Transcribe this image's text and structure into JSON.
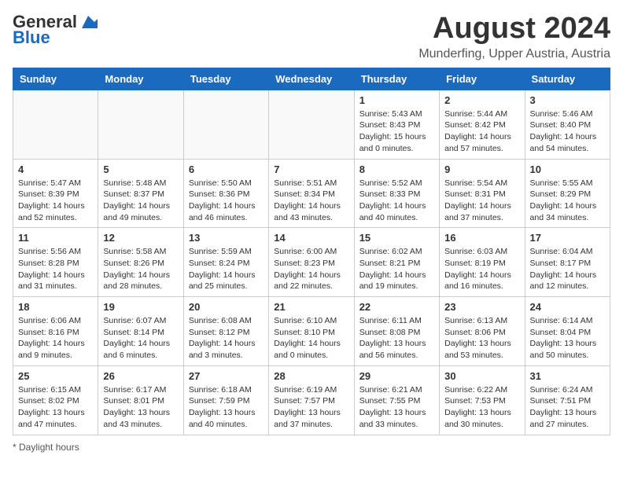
{
  "logo": {
    "line1": "General",
    "line2": "Blue"
  },
  "title": "August 2024",
  "subtitle": "Munderfing, Upper Austria, Austria",
  "day_headers": [
    "Sunday",
    "Monday",
    "Tuesday",
    "Wednesday",
    "Thursday",
    "Friday",
    "Saturday"
  ],
  "weeks": [
    [
      {
        "day": "",
        "info": ""
      },
      {
        "day": "",
        "info": ""
      },
      {
        "day": "",
        "info": ""
      },
      {
        "day": "",
        "info": ""
      },
      {
        "day": "1",
        "info": "Sunrise: 5:43 AM\nSunset: 8:43 PM\nDaylight: 15 hours and 0 minutes."
      },
      {
        "day": "2",
        "info": "Sunrise: 5:44 AM\nSunset: 8:42 PM\nDaylight: 14 hours and 57 minutes."
      },
      {
        "day": "3",
        "info": "Sunrise: 5:46 AM\nSunset: 8:40 PM\nDaylight: 14 hours and 54 minutes."
      }
    ],
    [
      {
        "day": "4",
        "info": "Sunrise: 5:47 AM\nSunset: 8:39 PM\nDaylight: 14 hours and 52 minutes."
      },
      {
        "day": "5",
        "info": "Sunrise: 5:48 AM\nSunset: 8:37 PM\nDaylight: 14 hours and 49 minutes."
      },
      {
        "day": "6",
        "info": "Sunrise: 5:50 AM\nSunset: 8:36 PM\nDaylight: 14 hours and 46 minutes."
      },
      {
        "day": "7",
        "info": "Sunrise: 5:51 AM\nSunset: 8:34 PM\nDaylight: 14 hours and 43 minutes."
      },
      {
        "day": "8",
        "info": "Sunrise: 5:52 AM\nSunset: 8:33 PM\nDaylight: 14 hours and 40 minutes."
      },
      {
        "day": "9",
        "info": "Sunrise: 5:54 AM\nSunset: 8:31 PM\nDaylight: 14 hours and 37 minutes."
      },
      {
        "day": "10",
        "info": "Sunrise: 5:55 AM\nSunset: 8:29 PM\nDaylight: 14 hours and 34 minutes."
      }
    ],
    [
      {
        "day": "11",
        "info": "Sunrise: 5:56 AM\nSunset: 8:28 PM\nDaylight: 14 hours and 31 minutes."
      },
      {
        "day": "12",
        "info": "Sunrise: 5:58 AM\nSunset: 8:26 PM\nDaylight: 14 hours and 28 minutes."
      },
      {
        "day": "13",
        "info": "Sunrise: 5:59 AM\nSunset: 8:24 PM\nDaylight: 14 hours and 25 minutes."
      },
      {
        "day": "14",
        "info": "Sunrise: 6:00 AM\nSunset: 8:23 PM\nDaylight: 14 hours and 22 minutes."
      },
      {
        "day": "15",
        "info": "Sunrise: 6:02 AM\nSunset: 8:21 PM\nDaylight: 14 hours and 19 minutes."
      },
      {
        "day": "16",
        "info": "Sunrise: 6:03 AM\nSunset: 8:19 PM\nDaylight: 14 hours and 16 minutes."
      },
      {
        "day": "17",
        "info": "Sunrise: 6:04 AM\nSunset: 8:17 PM\nDaylight: 14 hours and 12 minutes."
      }
    ],
    [
      {
        "day": "18",
        "info": "Sunrise: 6:06 AM\nSunset: 8:16 PM\nDaylight: 14 hours and 9 minutes."
      },
      {
        "day": "19",
        "info": "Sunrise: 6:07 AM\nSunset: 8:14 PM\nDaylight: 14 hours and 6 minutes."
      },
      {
        "day": "20",
        "info": "Sunrise: 6:08 AM\nSunset: 8:12 PM\nDaylight: 14 hours and 3 minutes."
      },
      {
        "day": "21",
        "info": "Sunrise: 6:10 AM\nSunset: 8:10 PM\nDaylight: 14 hours and 0 minutes."
      },
      {
        "day": "22",
        "info": "Sunrise: 6:11 AM\nSunset: 8:08 PM\nDaylight: 13 hours and 56 minutes."
      },
      {
        "day": "23",
        "info": "Sunrise: 6:13 AM\nSunset: 8:06 PM\nDaylight: 13 hours and 53 minutes."
      },
      {
        "day": "24",
        "info": "Sunrise: 6:14 AM\nSunset: 8:04 PM\nDaylight: 13 hours and 50 minutes."
      }
    ],
    [
      {
        "day": "25",
        "info": "Sunrise: 6:15 AM\nSunset: 8:02 PM\nDaylight: 13 hours and 47 minutes."
      },
      {
        "day": "26",
        "info": "Sunrise: 6:17 AM\nSunset: 8:01 PM\nDaylight: 13 hours and 43 minutes."
      },
      {
        "day": "27",
        "info": "Sunrise: 6:18 AM\nSunset: 7:59 PM\nDaylight: 13 hours and 40 minutes."
      },
      {
        "day": "28",
        "info": "Sunrise: 6:19 AM\nSunset: 7:57 PM\nDaylight: 13 hours and 37 minutes."
      },
      {
        "day": "29",
        "info": "Sunrise: 6:21 AM\nSunset: 7:55 PM\nDaylight: 13 hours and 33 minutes."
      },
      {
        "day": "30",
        "info": "Sunrise: 6:22 AM\nSunset: 7:53 PM\nDaylight: 13 hours and 30 minutes."
      },
      {
        "day": "31",
        "info": "Sunrise: 6:24 AM\nSunset: 7:51 PM\nDaylight: 13 hours and 27 minutes."
      }
    ]
  ],
  "footer": "Daylight hours"
}
